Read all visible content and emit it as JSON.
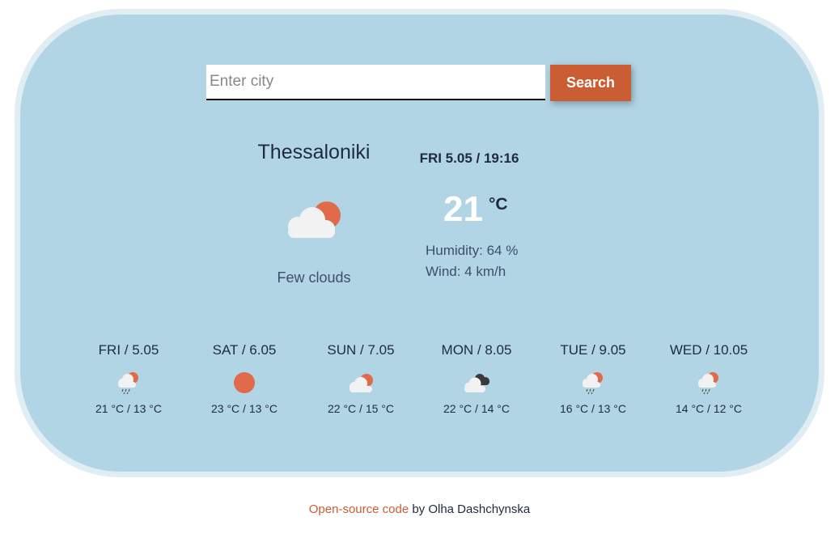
{
  "search": {
    "placeholder": "Enter city",
    "value": "",
    "button_label": "Search"
  },
  "current": {
    "city": "Thessaloniki",
    "datetime": "FRI 5.05 / 19:16",
    "icon": "few-clouds-icon",
    "description": "Few clouds",
    "temperature": "21",
    "unit": "°C",
    "humidity": "Humidity: 64 %",
    "wind": "Wind: 4 km/h"
  },
  "forecast": [
    {
      "day": "FRI / 5.05",
      "icon": "rain-icon",
      "temps": "21 °C / 13 °C"
    },
    {
      "day": "SAT / 6.05",
      "icon": "sun-icon",
      "temps": "23 °C / 13 °C"
    },
    {
      "day": "SUN / 7.05",
      "icon": "few-clouds-icon",
      "temps": "22 °C / 15 °C"
    },
    {
      "day": "MON / 8.05",
      "icon": "broken-clouds-icon",
      "temps": "22 °C / 14 °C"
    },
    {
      "day": "TUE / 9.05",
      "icon": "rain-icon",
      "temps": "16 °C / 13 °C"
    },
    {
      "day": "WED / 10.05",
      "icon": "rain-icon",
      "temps": "14 °C / 12 °C"
    }
  ],
  "footer": {
    "link_text": "Open-source code",
    "suffix": " by Olha Dashchynska"
  },
  "colors": {
    "card": "#b2d5e5",
    "accent": "#cb5d34",
    "sun": "#e06a4a",
    "cloud": "#f2f2f2",
    "dark_cloud": "#3a3a3a"
  }
}
